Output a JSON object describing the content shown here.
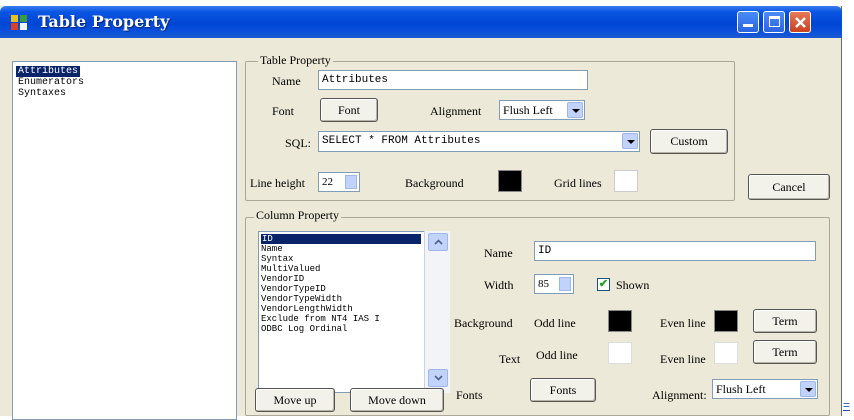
{
  "window": {
    "title": "Table Property"
  },
  "left_list": {
    "items": [
      "Attributes",
      "Enumerators",
      "Syntaxes"
    ],
    "selected_index": 0
  },
  "table_property": {
    "group_title": "Table Property",
    "name_label": "Name",
    "name_value": "Attributes",
    "font_label": "Font",
    "font_button": "Font",
    "alignment_label": "Alignment",
    "alignment_value": "Flush Left",
    "sql_label": "SQL:",
    "sql_value": "SELECT * FROM Attributes",
    "custom_button": "Custom",
    "line_height_label": "Line height",
    "line_height_value": "22",
    "background_label": "Background",
    "background_color": "#000000",
    "grid_lines_label": "Grid lines",
    "grid_lines_color": "#ffffff"
  },
  "cancel_button": "Cancel",
  "column_property": {
    "group_title": "Column Property",
    "columns": [
      "ID",
      "Name",
      "Syntax",
      "MultiValued",
      "VendorID",
      "VendorTypeID",
      "VendorTypeWidth",
      "VendorLengthWidth",
      "Exclude from NT4 IAS I",
      "ODBC Log Ordinal"
    ],
    "selected_index": 0,
    "name_label": "Name",
    "name_value": "ID",
    "width_label": "Width",
    "width_value": "85",
    "shown_label": "Shown",
    "shown_checked": true,
    "background_label": "Background",
    "odd_line_label": "Odd line",
    "odd_line_bg_color": "#000000",
    "even_line_label": "Even line",
    "even_line_bg_color": "#000000",
    "term_button": "Term",
    "text_label": "Text",
    "odd_line_text_color": "#ffffff",
    "even_line_text_color": "#ffffff",
    "term_button_2": "Term",
    "fonts_label": "Fonts",
    "fonts_button": "Fonts",
    "alignment_label": "Alignment:",
    "alignment_value": "Flush Left",
    "move_up_button": "Move up",
    "move_down_button": "Move down"
  },
  "help_link": "="
}
